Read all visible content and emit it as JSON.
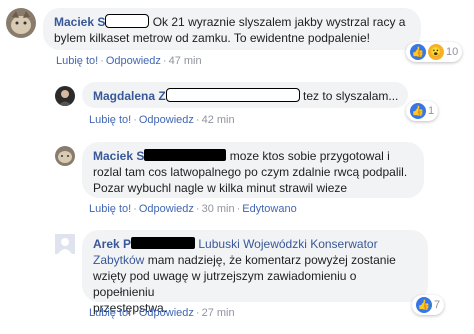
{
  "comments": [
    {
      "author": "Maciek S",
      "text_a": "Ok 21 wyraznie slyszalem jakby wystrzal racy a",
      "text_b": "bylem kilkaset metrow od zamku. To ewidentne podpalenie!",
      "actions": {
        "like": "Lubię to!",
        "reply": "Odpowiedz",
        "time": "47 min"
      },
      "reactions": {
        "count": "10",
        "icons": [
          "like-icon",
          "wow-icon"
        ]
      }
    },
    {
      "author": "Magdalena Z",
      "text_a": "tez to slyszalam...",
      "actions": {
        "like": "Lubię to!",
        "reply": "Odpowiedz",
        "time": "42 min"
      },
      "reactions": {
        "count": "1",
        "icons": [
          "like-icon"
        ]
      }
    },
    {
      "author": "Maciek S",
      "text_a": "moze ktos sobie przygotowal i",
      "text_b": "rozlal tam cos latwopalnego po czym zdalnie rwcą podpalil.",
      "text_c": "Pozar wybuchl nagle w kilka minut strawil wieze",
      "actions": {
        "like": "Lubię to!",
        "reply": "Odpowiedz",
        "time": "30 min",
        "edited": "Edytowano"
      }
    },
    {
      "author": "Arek P",
      "mention_a": "Lubuski Wojewódzki Konserwator",
      "mention_b": "Zabytków",
      "text_a": "mam nadzieję, że komentarz powyżej zostanie",
      "text_b": "wzięty pod uwagę w jutrzejszym zawiadomieniu o popełnieniu",
      "text_c": "przestępstwa.",
      "actions": {
        "like": "Lubię to!",
        "reply": "Odpowiedz",
        "time": "27 min"
      },
      "reactions": {
        "count": "7",
        "icons": [
          "like-icon"
        ]
      }
    }
  ],
  "colors": {
    "author": "#385898",
    "bubble": "#f2f3f5",
    "like": "#3578e5",
    "wow": "#f7b125"
  }
}
